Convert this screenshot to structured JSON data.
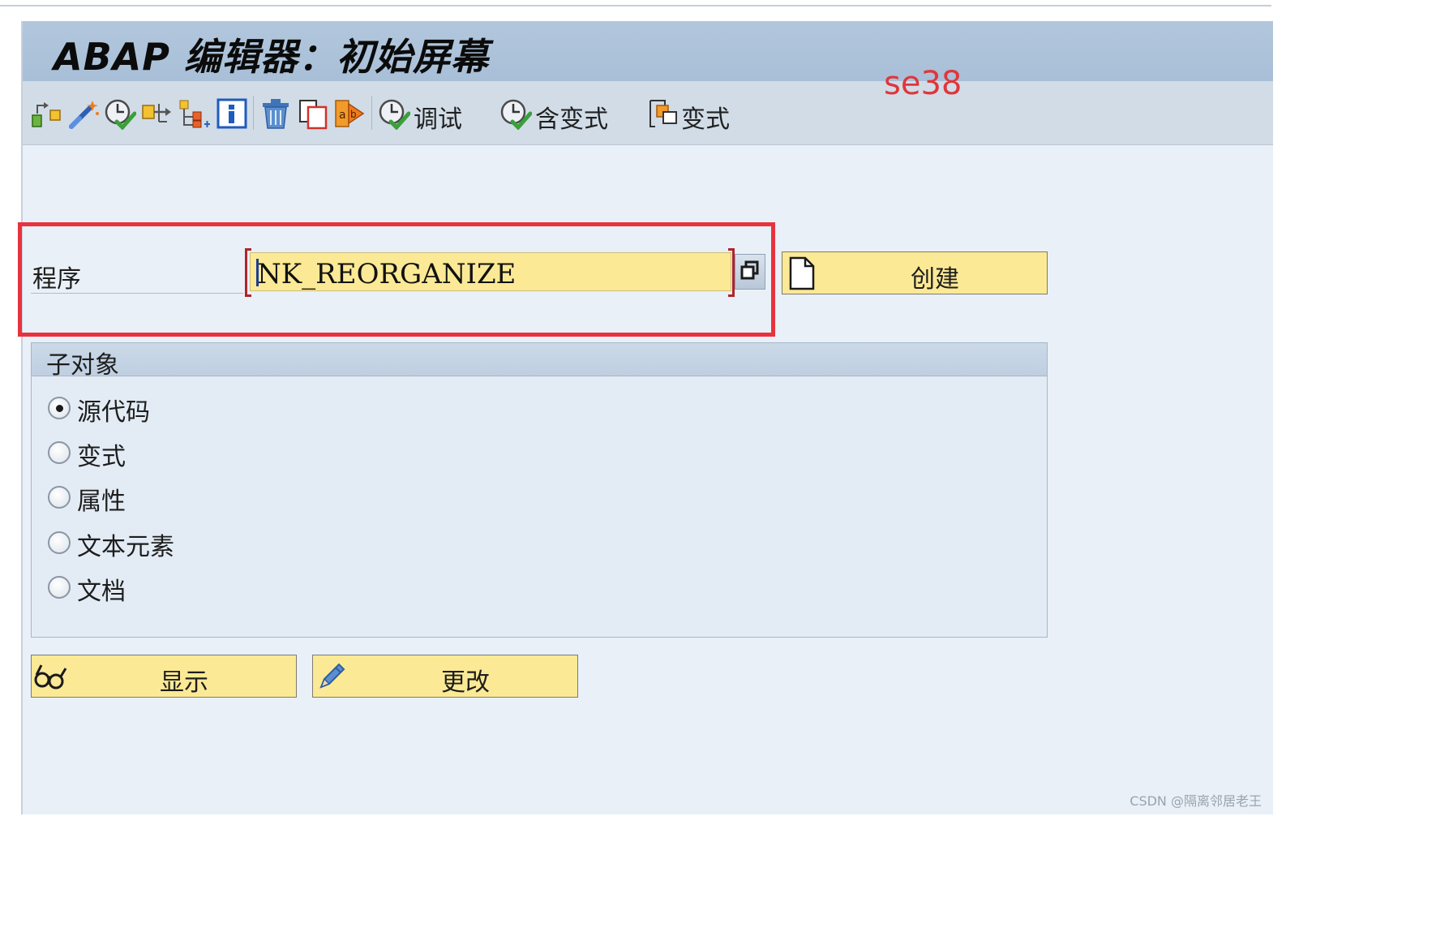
{
  "window": {
    "title": "ABAP 编辑器：初始屏幕",
    "annotation": "se38"
  },
  "toolbar": {
    "icons": [
      "other-object-icon",
      "magic-wand-icon",
      "check-syntax-icon",
      "where-used-icon",
      "display-object-list-icon",
      "info-icon",
      "delete-icon",
      "copy-icon",
      "rename-icon"
    ],
    "debug_label": "调试",
    "with_variant_label": "含变式",
    "variants_label": "变式"
  },
  "program": {
    "label": "程序",
    "value": "NK_REORGANIZE",
    "create_label": "创建"
  },
  "subobjects": {
    "title": "子对象",
    "selected": "源代码",
    "options": [
      "源代码",
      "变式",
      "属性",
      "文本元素",
      "文档"
    ]
  },
  "actions": {
    "display_label": "显示",
    "change_label": "更改"
  },
  "watermark": "CSDN @隔离邻居老王",
  "colors": {
    "title_bar": "#a8bfd7",
    "toolbar": "#d1dce7",
    "input_bg": "#fbe995",
    "highlight": "#e8323d"
  }
}
